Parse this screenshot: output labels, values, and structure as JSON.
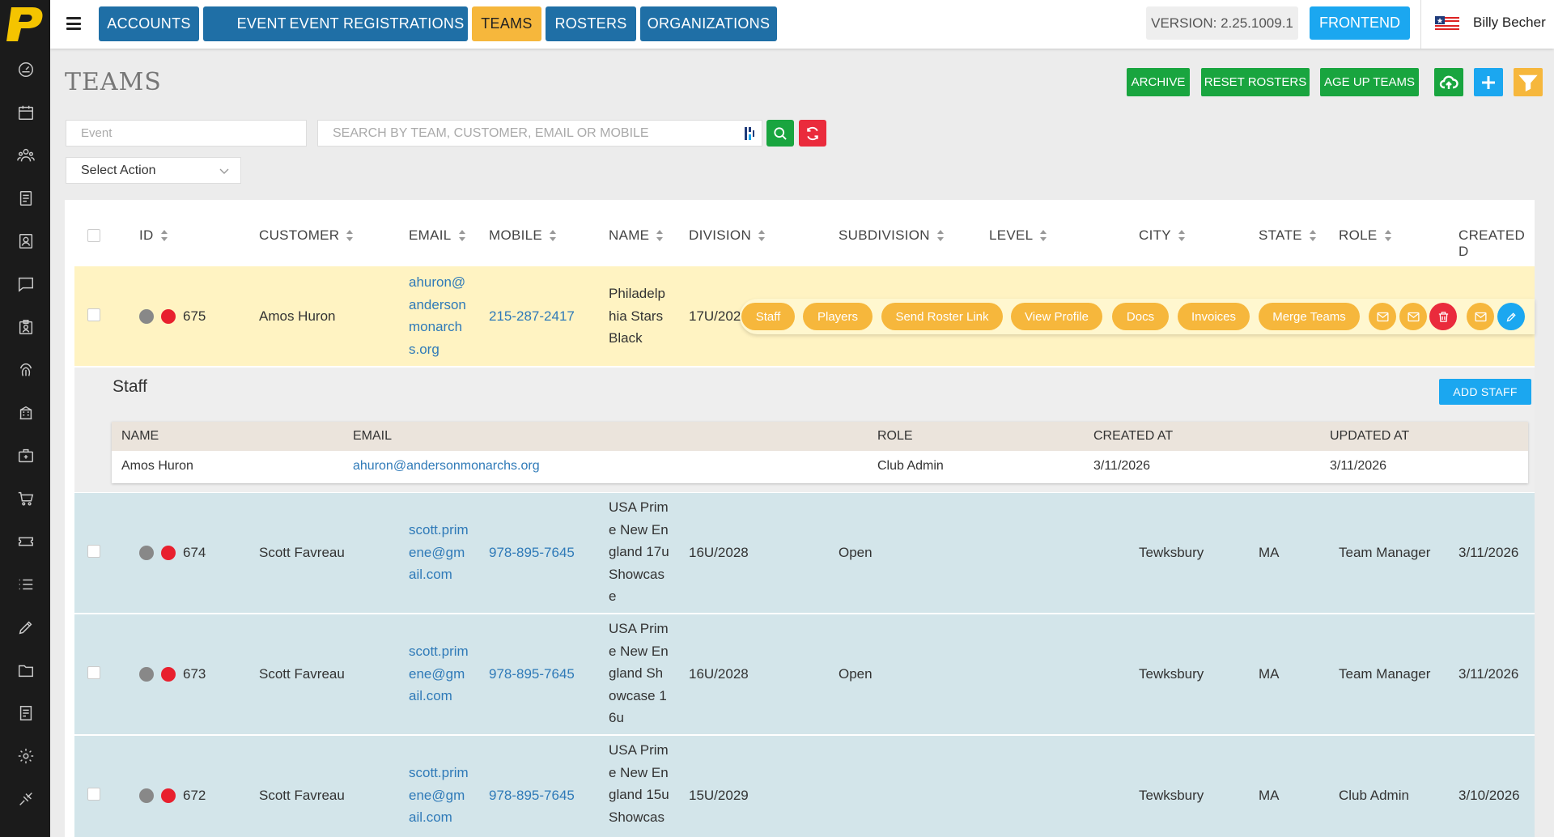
{
  "nav": {
    "tabs": [
      {
        "label": "ACCOUNTS"
      },
      {
        "label": "EVENTS"
      },
      {
        "label": "EVENT REGISTRATIONS"
      },
      {
        "label": "TEAMS",
        "active": true
      },
      {
        "label": "ROSTERS"
      },
      {
        "label": "ORGANIZATIONS"
      }
    ],
    "version": "VERSION: 2.25.1009.1",
    "frontend": "FRONTEND",
    "user": "Billy Becher"
  },
  "page": {
    "title": "TEAMS",
    "actions": {
      "archive": "ARCHIVE",
      "reset_rosters": "RESET ROSTERS",
      "age_up": "AGE UP TEAMS"
    }
  },
  "filters": {
    "event_placeholder": "Event",
    "search_placeholder": "SEARCH BY TEAM, CUSTOMER, EMAIL OR MOBILE",
    "select_action": "Select Action"
  },
  "table": {
    "headers": [
      "ID",
      "CUSTOMER",
      "EMAIL",
      "MOBILE",
      "NAME",
      "DIVISION",
      "SUBDIVISION",
      "LEVEL",
      "CITY",
      "STATE",
      "ROLE",
      "CREATED D"
    ],
    "rows": [
      {
        "id": "675",
        "customer": "Amos Huron",
        "email_lines": [
          "ahuron@",
          "anderson",
          "monarch",
          "s.org"
        ],
        "mobile": "215-287-2417",
        "name_lines": [
          "Philadelp",
          "hia Stars",
          "Black"
        ],
        "division": "17U/202",
        "subdivision": "",
        "level": "",
        "city": "",
        "state": "",
        "role": "",
        "created": ""
      },
      {
        "id": "674",
        "customer": "Scott Favreau",
        "email_lines": [
          "scott.prim",
          "ene@gm",
          "ail.com"
        ],
        "mobile": "978-895-7645",
        "name_lines": [
          "USA Prim",
          "e New En",
          "gland 17u",
          "Showcas",
          "e"
        ],
        "division": "16U/2028",
        "subdivision": "Open",
        "level": "",
        "city": "Tewksbury",
        "state": "MA",
        "role": "Team Manager",
        "created": "3/11/2026"
      },
      {
        "id": "673",
        "customer": "Scott Favreau",
        "email_lines": [
          "scott.prim",
          "ene@gm",
          "ail.com"
        ],
        "mobile": "978-895-7645",
        "name_lines": [
          "USA Prim",
          "e New En",
          "gland Sh",
          "owcase 1",
          "6u"
        ],
        "division": "16U/2028",
        "subdivision": "Open",
        "level": "",
        "city": "Tewksbury",
        "state": "MA",
        "role": "Team Manager",
        "created": "3/11/2026"
      },
      {
        "id": "672",
        "customer": "Scott Favreau",
        "email_lines": [
          "scott.prim",
          "ene@gm",
          "ail.com"
        ],
        "mobile": "978-895-7645",
        "name_lines": [
          "USA Prim",
          "e New En",
          "gland 15u",
          "Showcas"
        ],
        "division": "15U/2029",
        "subdivision": "",
        "level": "",
        "city": "Tewksbury",
        "state": "MA",
        "role": "Club Admin",
        "created": "3/10/2026"
      }
    ]
  },
  "row_actions": [
    "Staff",
    "Players",
    "Send Roster Link",
    "View Profile",
    "Docs",
    "Invoices",
    "Merge Teams"
  ],
  "staff": {
    "title": "Staff",
    "add_button": "ADD STAFF",
    "headers": [
      "NAME",
      "EMAIL",
      "ROLE",
      "CREATED AT",
      "UPDATED AT"
    ],
    "rows": [
      {
        "name": "Amos Huron",
        "email": "ahuron@andersonmonarchs.org",
        "role": "Club Admin",
        "created": "3/11/2026",
        "updated": "3/11/2026"
      }
    ]
  },
  "colors": {
    "nav_blue": "#1f6fa6",
    "active_tab": "#f6b73c",
    "green": "#19a53f",
    "blue": "#1ba7f0",
    "red": "#ea2b3c",
    "orange": "#f6b73c",
    "selected_row": "#fff3c2",
    "alt_row": "#d3e5ea"
  }
}
